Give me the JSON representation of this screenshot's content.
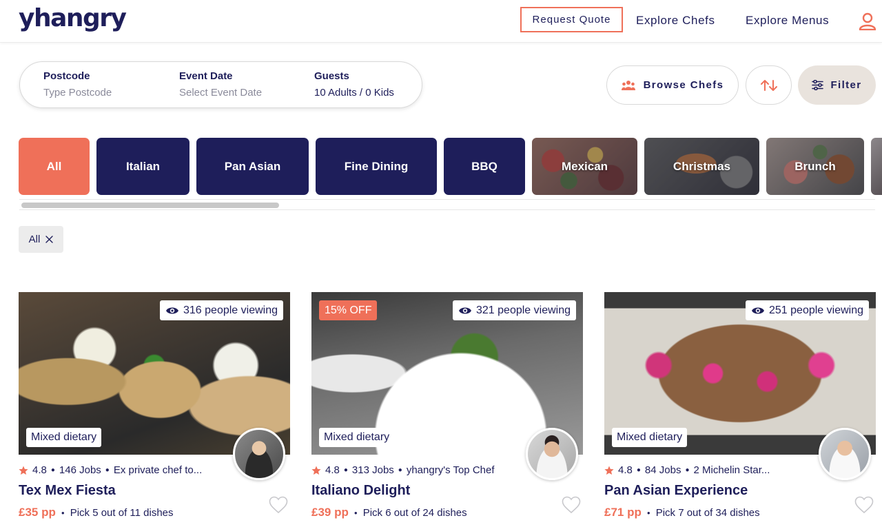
{
  "brand": {
    "logo_text": "yhangry"
  },
  "header": {
    "request_quote": "Request Quote",
    "explore_chefs": "Explore Chefs",
    "explore_menus": "Explore Menus"
  },
  "search": {
    "postcode_label": "Postcode",
    "postcode_placeholder": "Type Postcode",
    "date_label": "Event Date",
    "date_placeholder": "Select Event Date",
    "guests_label": "Guests",
    "guests_value": "10 Adults / 0 Kids"
  },
  "controls": {
    "browse_chefs": "Browse Chefs",
    "filter": "Filter"
  },
  "categories": [
    {
      "label": "All"
    },
    {
      "label": "Italian"
    },
    {
      "label": "Pan Asian"
    },
    {
      "label": "Fine Dining"
    },
    {
      "label": "BBQ"
    },
    {
      "label": "Mexican"
    },
    {
      "label": "Christmas"
    },
    {
      "label": "Brunch"
    }
  ],
  "active_filter": {
    "label": "All"
  },
  "cards": [
    {
      "viewing": "316 people viewing",
      "dietary": "Mixed dietary",
      "rating": "4.8",
      "jobs": "146 Jobs",
      "chef_note": "Ex private chef to...",
      "title": "Tex Mex Fiesta",
      "price": "£35 pp",
      "pick": "Pick 5 out of 11 dishes"
    },
    {
      "discount": "15% OFF",
      "viewing": "321 people viewing",
      "dietary": "Mixed dietary",
      "rating": "4.8",
      "jobs": "313 Jobs",
      "chef_note": "yhangry's Top Chef",
      "title": "Italiano Delight",
      "price": "£39 pp",
      "pick": "Pick 6 out of 24 dishes"
    },
    {
      "viewing": "251 people viewing",
      "dietary": "Mixed dietary",
      "rating": "4.8",
      "jobs": "84 Jobs",
      "chef_note": "2 Michelin Star...",
      "title": "Pan Asian Experience",
      "price": "£71 pp",
      "pick": "Pick 7 out of 34 dishes"
    }
  ],
  "icons": {
    "user": "user-icon",
    "people": "people-icon",
    "sort": "sort-arrows-icon",
    "filter": "sliders-icon",
    "eye": "eye-icon",
    "star": "star-icon",
    "heart": "heart-icon",
    "close": "close-icon"
  },
  "colors": {
    "navy": "#1e1e5a",
    "coral": "#ef7059",
    "filter_bg": "#e9e3dd"
  }
}
